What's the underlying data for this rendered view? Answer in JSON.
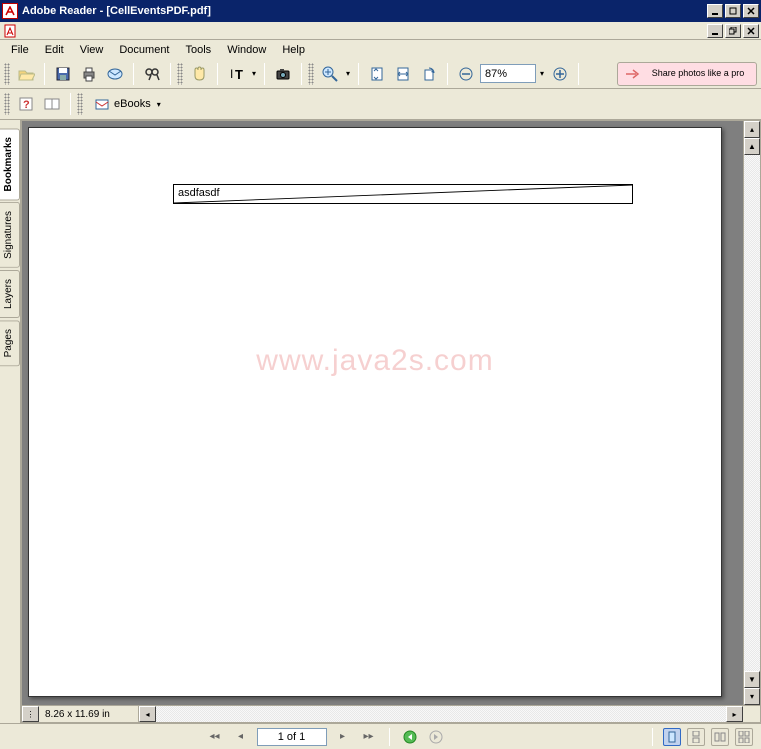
{
  "titlebar": {
    "title": "Adobe Reader - [CellEventsPDF.pdf]"
  },
  "menubar": {
    "items": [
      "File",
      "Edit",
      "View",
      "Document",
      "Tools",
      "Window",
      "Help"
    ]
  },
  "toolbar": {
    "zoom_value": "87%",
    "ebooks_label": "eBooks",
    "share_text": "Share photos like a pro"
  },
  "sidetabs": {
    "items": [
      "Bookmarks",
      "Signatures",
      "Layers",
      "Pages"
    ]
  },
  "document": {
    "cell_text": "asdfasdf",
    "watermark": "www.java2s.com",
    "dimensions": "8.26 x 11.69 in"
  },
  "navbar": {
    "page_display": "1 of 1"
  },
  "icons": {
    "open": "open",
    "save": "save",
    "print": "print",
    "email": "email",
    "search": "search",
    "hand": "hand",
    "text-select": "text-select",
    "snapshot": "snapshot",
    "zoom-in": "zoom-in",
    "fit-page": "fit-page",
    "fit-width": "fit-width",
    "rotate": "rotate",
    "minus": "minus",
    "plus": "plus",
    "help": "help",
    "ebook": "ebook",
    "arrow": "arrow"
  }
}
